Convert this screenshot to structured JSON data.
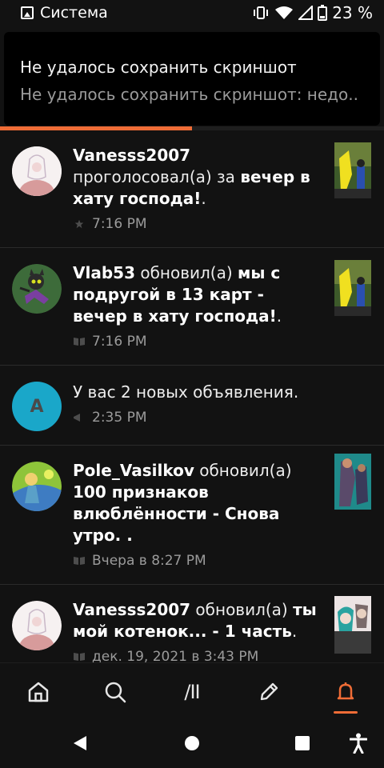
{
  "status_bar": {
    "app_label": "Система",
    "battery": "23 %",
    "icons": [
      "image-icon",
      "vibrate-icon",
      "wifi-icon",
      "signal-icon",
      "battery-icon"
    ]
  },
  "toast": {
    "title": "Не удалось сохранить скриншот",
    "text": "Не удалось сохранить скриншот: недо..",
    "progress": 0.5
  },
  "colors": {
    "accent": "#ef6c36",
    "background": "#121212"
  },
  "feed": [
    {
      "user": "Vanesss2007",
      "action": "проголосовал(а) за",
      "story": "вечер в хату господа!",
      "tail": ".",
      "time": "7:16 PM",
      "icon": "star-icon"
    },
    {
      "user": "Vlab53",
      "action": "обновил(а)",
      "story": "мы с подругой в 13 карт - вечер в хату господа!",
      "tail": ".",
      "time": "7:16 PM",
      "icon": "book-icon"
    },
    {
      "avatar_letter": "A",
      "message": "У вас 2 новых объявления.",
      "time": "2:35 PM",
      "icon": "megaphone-icon"
    },
    {
      "user": "Pole_Vasilkov",
      "action": "обновил(а)",
      "story": "100 признаков влюблённости - Снова утро. .",
      "tail": "",
      "time": "Вчера в 8:27 PM",
      "icon": "book-icon"
    },
    {
      "user": "Vanesss2007",
      "action": "обновил(а)",
      "story": "ты мой котенок... - 1 часть",
      "tail": ".",
      "time": "дек. 19, 2021 в 3:43 PM",
      "icon": "book-icon"
    }
  ],
  "bottom_nav": [
    {
      "name": "home-icon",
      "glyph": "⌂"
    },
    {
      "name": "search-icon",
      "glyph": ""
    },
    {
      "name": "library-icon",
      "glyph": "/II"
    },
    {
      "name": "write-icon",
      "glyph": ""
    },
    {
      "name": "notifications-icon",
      "glyph": "",
      "active": true
    }
  ],
  "system_nav": [
    "back-icon",
    "home-circle-icon",
    "recents-icon",
    "accessibility-icon"
  ]
}
